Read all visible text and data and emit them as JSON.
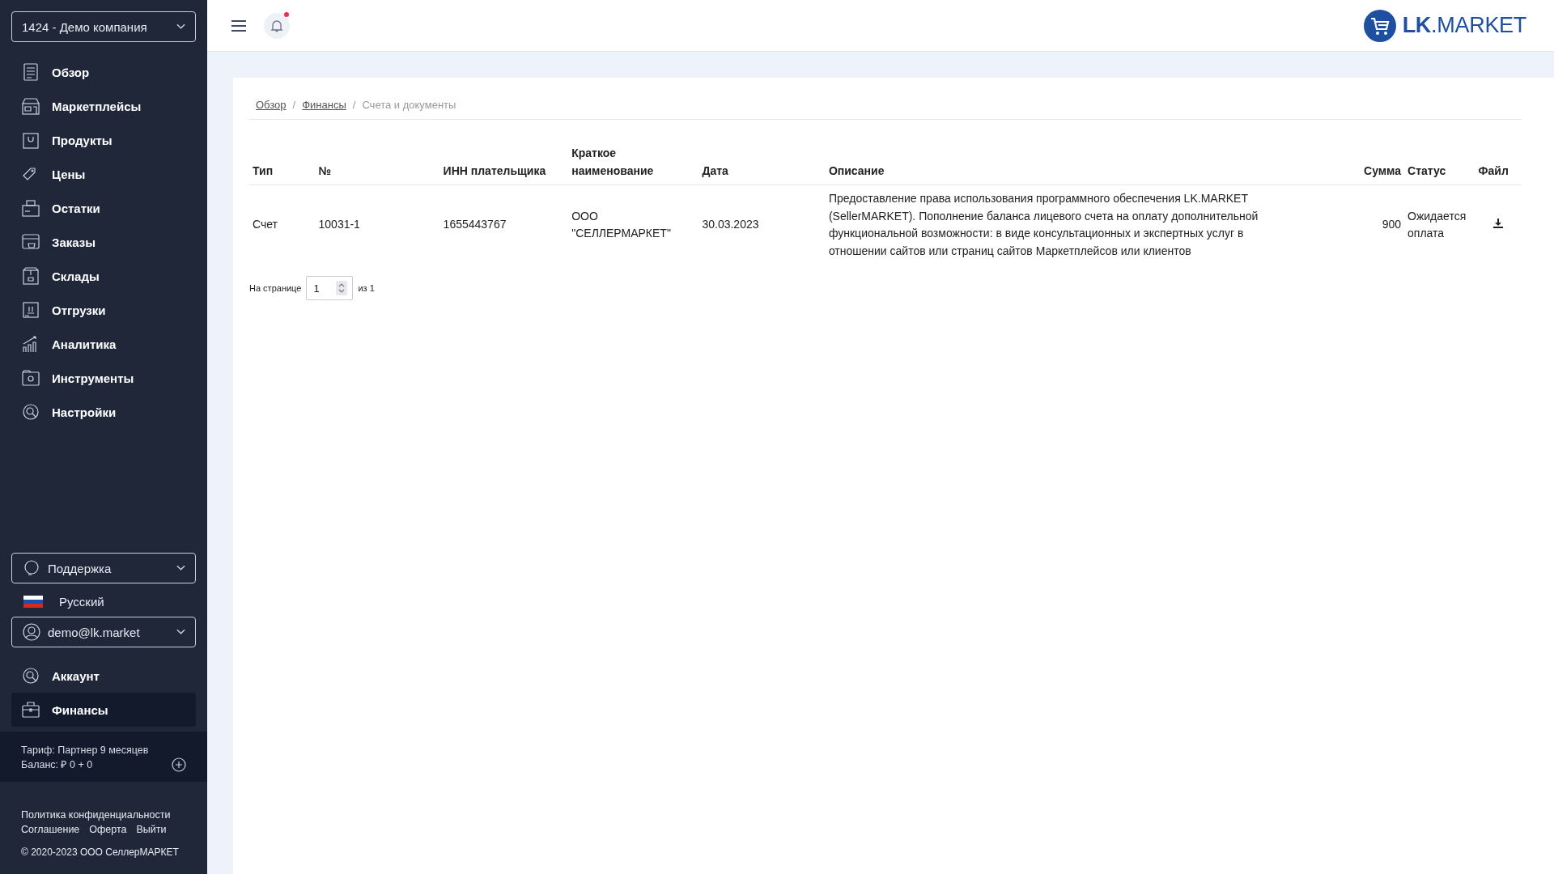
{
  "company_selector": {
    "value": "1424 - Демо компания"
  },
  "nav": [
    {
      "label": "Обзор",
      "selected": false
    },
    {
      "label": "Маркетплейсы",
      "selected": false
    },
    {
      "label": "Продукты",
      "selected": false
    },
    {
      "label": "Цены",
      "selected": false
    },
    {
      "label": "Остатки",
      "selected": false
    },
    {
      "label": "Заказы",
      "selected": false
    },
    {
      "label": "Склады",
      "selected": false
    },
    {
      "label": "Отгрузки",
      "selected": false
    },
    {
      "label": "Аналитика",
      "selected": false
    },
    {
      "label": "Инструменты",
      "selected": false
    },
    {
      "label": "Настройки",
      "selected": false
    }
  ],
  "support": {
    "label": "Поддержка"
  },
  "language": {
    "label": "Русский"
  },
  "user": {
    "email": "demo@lk.market"
  },
  "account_nav": [
    {
      "label": "Аккаунт",
      "selected": false
    },
    {
      "label": "Финансы",
      "selected": true
    }
  ],
  "tariff": {
    "plan": "Тариф: Партнер 9 месяцев",
    "balance": "Баланс: ₽ 0 + 0"
  },
  "footer": {
    "links": [
      [
        "Политика конфиденциальности"
      ],
      [
        "Соглашение",
        "Оферта",
        "Выйти"
      ]
    ],
    "copyright": "© 2020-2023 ООО СеллерМАРКЕТ"
  },
  "header": {
    "has_notification": true,
    "logo": "**LK**.MARKET"
  },
  "breadcrumb_separator": "/",
  "breadcrumbs": [
    {
      "label": "Обзор",
      "link": true
    },
    {
      "label": "Финансы",
      "link": true
    },
    {
      "label": "Счета и документы",
      "link": false
    }
  ],
  "table": {
    "columns": [
      "Тип",
      "№",
      "ИНН плательщика",
      "Краткое наименование",
      "Дата",
      "Описание",
      "Сумма",
      "Статус",
      "Файл"
    ],
    "rows": [
      {
        "cells": [
          "Счет",
          "10031-1",
          "1655443767",
          "ООО \"СЕЛЛЕРМАРКЕТ\"",
          "30.03.2023",
          "Предоставление права использования программного обеспечения LK.MARKET (SellerMARKET). Пополнение баланса лицевого счета на оплату дополнительной функциональной возможности: в виде консультационных и экспертных услуг в отношении сайтов или страниц сайтов Маркетплейсов или клиентов",
          "900",
          "Ожидается оплата"
        ]
      }
    ]
  },
  "pagination": {
    "label": "На странице",
    "value": "1",
    "total": "из 1"
  }
}
